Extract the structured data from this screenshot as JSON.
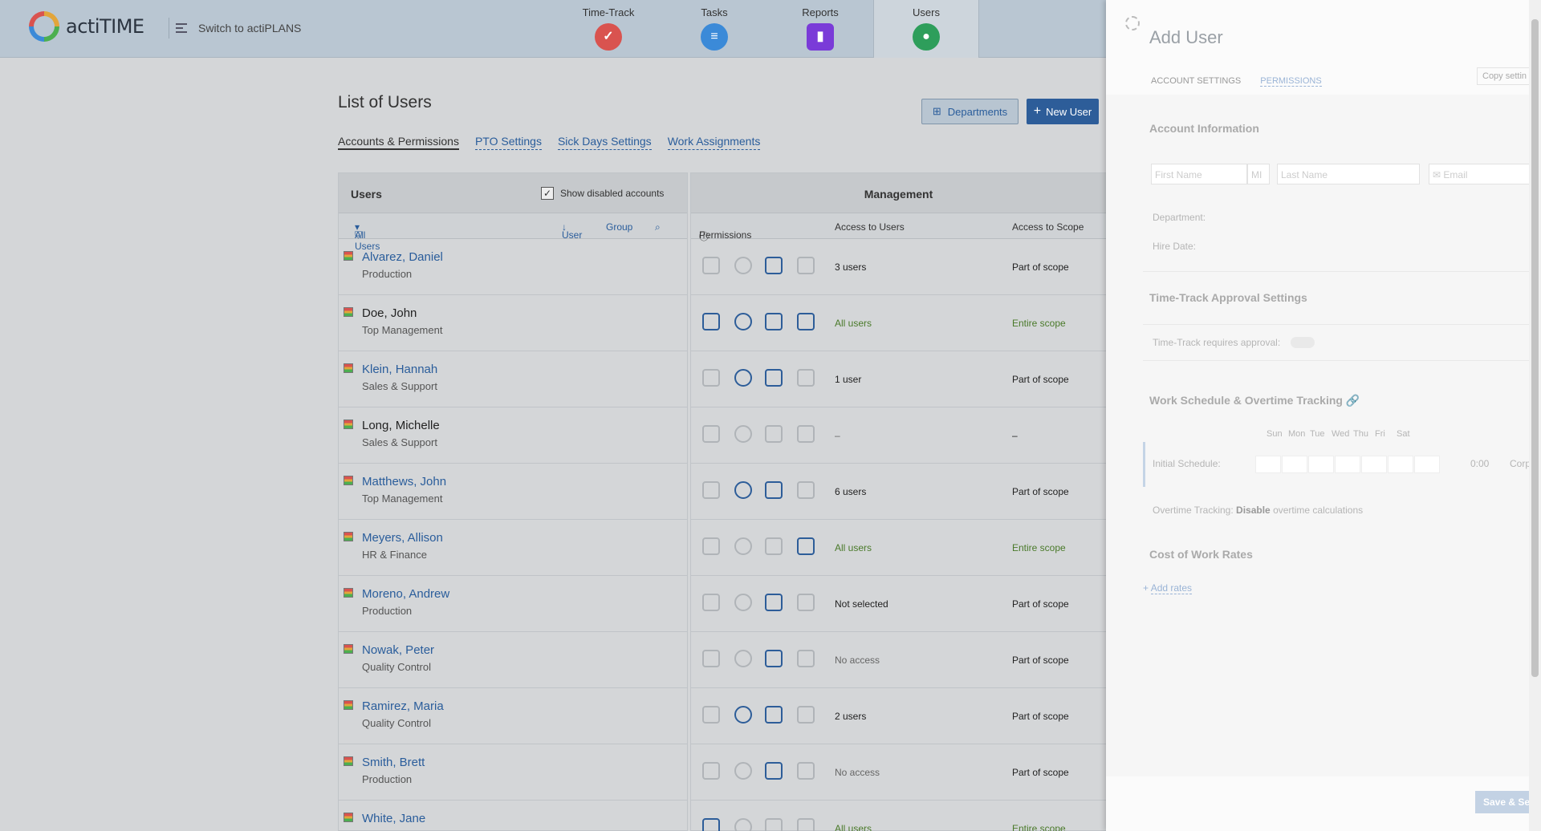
{
  "app": {
    "name": "actiTIME",
    "switch_label": "Switch to actiPLANS"
  },
  "nav": [
    {
      "label": "Time-Track",
      "icon": "check-icon",
      "color": "#d9534f"
    },
    {
      "label": "Tasks",
      "icon": "list-icon",
      "color": "#3b8ad8"
    },
    {
      "label": "Reports",
      "icon": "chart-icon",
      "color": "#7a3bd8"
    },
    {
      "label": "Users",
      "icon": "user-icon",
      "color": "#2e9e5b"
    }
  ],
  "page": {
    "title": "List of Users",
    "tabs": [
      "Accounts & Permissions",
      "PTO Settings",
      "Sick Days Settings",
      "Work Assignments"
    ],
    "departments_button": "Departments",
    "new_user_button": "New User"
  },
  "users_table": {
    "header": "Users",
    "show_disabled": "Show disabled accounts",
    "filter": "All Users",
    "sort_user": "User",
    "group": "Group",
    "management_header": "Management",
    "permissions": "Permissions",
    "access_users": "Access to Users",
    "access_scope": "Access to Scope",
    "rows": [
      {
        "name": "Alvarez, Daniel",
        "dept": "Production",
        "access": "3 users",
        "scope": "Part of scope",
        "perms": [
          false,
          false,
          true,
          false
        ],
        "linked": true
      },
      {
        "name": "Doe, John",
        "dept": "Top Management",
        "access": "All users",
        "scope": "Entire scope",
        "perms": [
          true,
          true,
          true,
          true
        ],
        "linked": false
      },
      {
        "name": "Klein, Hannah",
        "dept": "Sales & Support",
        "access": "1 user",
        "scope": "Part of scope",
        "perms": [
          false,
          true,
          true,
          false
        ],
        "linked": true
      },
      {
        "name": "Long, Michelle",
        "dept": "Sales & Support",
        "access": "–",
        "scope": "–",
        "perms": [
          false,
          false,
          false,
          false
        ],
        "linked": false
      },
      {
        "name": "Matthews, John",
        "dept": "Top Management",
        "access": "6 users",
        "scope": "Part of scope",
        "perms": [
          false,
          true,
          true,
          false
        ],
        "linked": true
      },
      {
        "name": "Meyers, Allison",
        "dept": "HR & Finance",
        "access": "All users",
        "scope": "Entire scope",
        "perms": [
          false,
          false,
          false,
          true
        ],
        "linked": true
      },
      {
        "name": "Moreno, Andrew",
        "dept": "Production",
        "access": "Not selected",
        "scope": "Part of scope",
        "perms": [
          false,
          false,
          true,
          false
        ],
        "linked": true
      },
      {
        "name": "Nowak, Peter",
        "dept": "Quality Control",
        "access": "No access",
        "scope": "Part of scope",
        "perms": [
          false,
          false,
          true,
          false
        ],
        "linked": true
      },
      {
        "name": "Ramirez, Maria",
        "dept": "Quality Control",
        "access": "2 users",
        "scope": "Part of scope",
        "perms": [
          false,
          true,
          true,
          false
        ],
        "linked": true
      },
      {
        "name": "Smith, Brett",
        "dept": "Production",
        "access": "No access",
        "scope": "Part of scope",
        "perms": [
          false,
          false,
          true,
          false
        ],
        "linked": true
      },
      {
        "name": "White, Jane",
        "dept": "",
        "access": "All users",
        "scope": "Entire scope",
        "perms": [
          true,
          false,
          false,
          false
        ],
        "linked": true
      }
    ]
  },
  "panel": {
    "title": "Add User",
    "tabs": [
      "ACCOUNT SETTINGS",
      "PERMISSIONS"
    ],
    "copy_settings": "Copy settin",
    "account_info": "Account Information",
    "first_name": "First Name",
    "mi": "MI",
    "last_name": "Last Name",
    "email": "Email",
    "department": "Department:",
    "hire_date": "Hire Date:",
    "tt_approval": "Time-Track Approval Settings",
    "tt_requires": "Time-Track requires approval:",
    "work_schedule": "Work Schedule & Overtime Tracking",
    "days": [
      "Sun",
      "Mon",
      "Tue",
      "Wed",
      "Thu",
      "Fri",
      "Sat"
    ],
    "initial_schedule": "Initial Schedule:",
    "schedule_total": "0:00",
    "schedule_corp": "Corp",
    "overtime_label": "Overtime Tracking:",
    "overtime_value": "Disable",
    "overtime_rest": "overtime calculations",
    "cost_rates": "Cost of Work Rates",
    "add_rates": "Add rates",
    "save": "Save & Se"
  }
}
